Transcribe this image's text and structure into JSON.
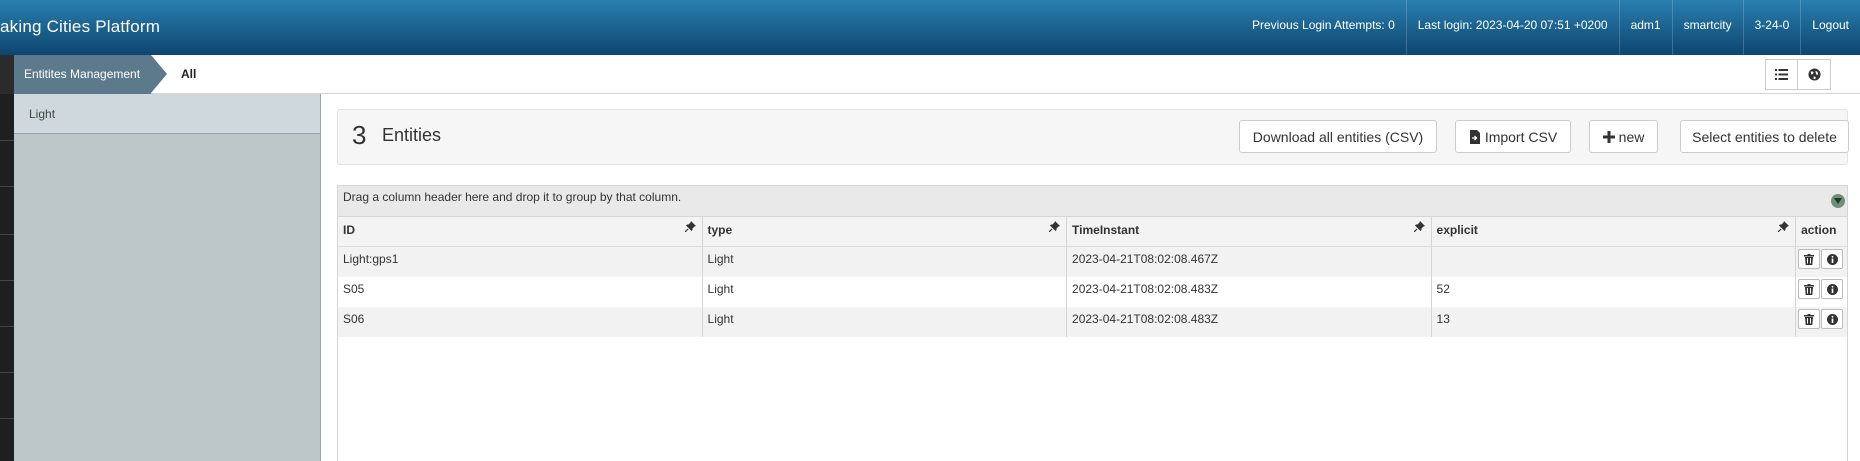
{
  "header": {
    "brand": "aking Cities Platform",
    "nav": [
      {
        "label": "Previous Login Attempts: 0"
      },
      {
        "label": "Last login: 2023-04-20 07:51 +0200"
      },
      {
        "label": "adm1"
      },
      {
        "label": "smartcity"
      },
      {
        "label": "3-24-0"
      },
      {
        "label": "Logout"
      }
    ]
  },
  "breadcrumb": {
    "section": "Entitites Management",
    "current": "All"
  },
  "sidebar": {
    "items": [
      {
        "label": "Light"
      }
    ]
  },
  "main": {
    "count": "3",
    "count_label": "Entities",
    "buttons": {
      "download": "Download all entities (CSV)",
      "import": "Import CSV",
      "new": "new",
      "delete": "Select entities to delete"
    }
  },
  "grid": {
    "group_hint": "Drag a column header here and drop it to group by that column.",
    "columns": [
      "ID",
      "type",
      "TimeInstant",
      "explicit",
      "action"
    ],
    "rows": [
      {
        "id": "Light:gps1",
        "type": "Light",
        "time": "2023-04-21T08:02:08.467Z",
        "explicit": ""
      },
      {
        "id": "S05",
        "type": "Light",
        "time": "2023-04-21T08:02:08.483Z",
        "explicit": "52"
      },
      {
        "id": "S06",
        "type": "Light",
        "time": "2023-04-21T08:02:08.483Z",
        "explicit": "13"
      }
    ]
  },
  "icons": {
    "list_view": "list-icon",
    "map_view": "globe-icon",
    "import": "file-import-icon",
    "new": "plus-icon",
    "pin": "pin-icon",
    "delete": "trash-icon",
    "info": "info-icon",
    "collapse": "chevron-down-icon"
  },
  "colors": {
    "header": "#1a5f8c",
    "breadcrumb": "#5d7a8c",
    "sidebar": "#bcc5c8"
  }
}
